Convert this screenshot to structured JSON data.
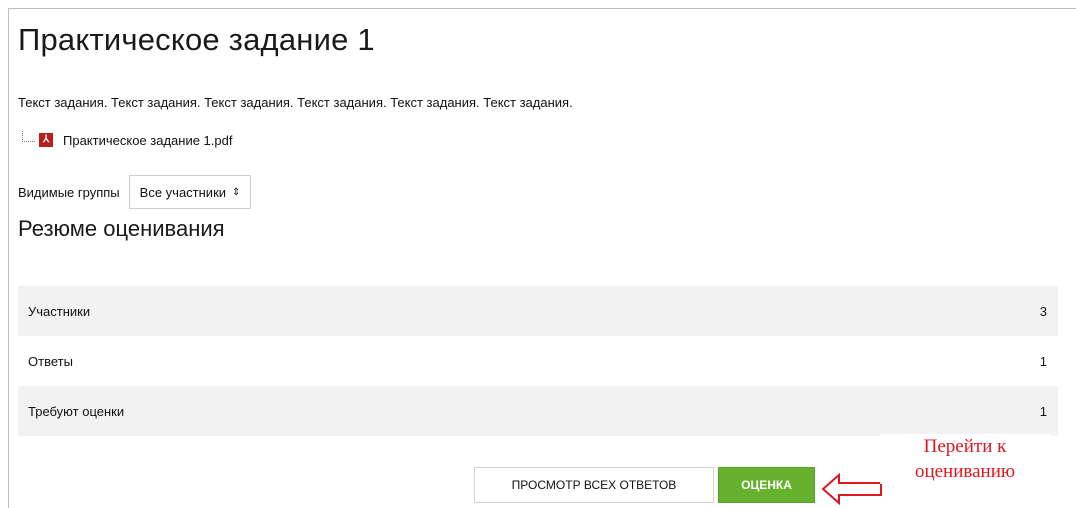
{
  "page": {
    "title": "Практическое задание 1",
    "description": "Текст задания. Текст задания. Текст задания. Текст задания. Текст задания. Текст задания."
  },
  "attachment": {
    "icon": "pdf-icon",
    "icon_glyph": "⅄",
    "filename": "Практическое задание 1.pdf"
  },
  "groups": {
    "label": "Видимые группы",
    "selected": "Все участники",
    "caret": "⇕"
  },
  "summary": {
    "title": "Резюме оценивания",
    "rows": [
      {
        "label": "Участники",
        "value": "3"
      },
      {
        "label": "Ответы",
        "value": "1"
      },
      {
        "label": "Требуют оценки",
        "value": "1"
      }
    ]
  },
  "buttons": {
    "view_all": "ПРОСМОТР ВСЕХ ОТВЕТОВ",
    "grade": "ОЦЕНКА"
  },
  "annotation": {
    "line1": "Перейти к",
    "line2": "оцениванию",
    "color": "#e0161e"
  },
  "colors": {
    "grade_button": "#66b22f",
    "row_shade": "#f2f2f2",
    "pdf_icon": "#b8201d"
  }
}
